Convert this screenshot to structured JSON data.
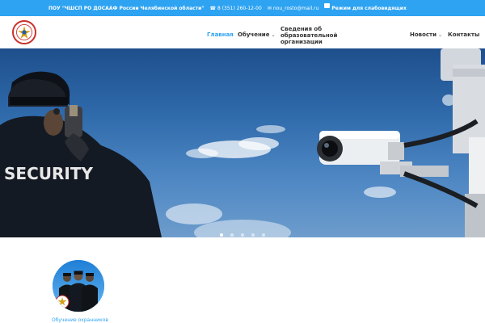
{
  "topbar": {
    "org_name": "ПОУ \"ЧШСП РО ДОСААФ России Челябинской области\"",
    "phone": "8 (351) 260-12-00",
    "email": "nou_rosto@mail.ru",
    "accessibility": "Режим для слабовидящих",
    "bg_color": "#2ea3f2"
  },
  "header": {
    "logo": "dosaaf-emblem-icon",
    "nav": [
      {
        "label": "Главная",
        "active": true
      },
      {
        "label": "Обучение",
        "has_dropdown": true
      },
      {
        "label": "Сведения об образовательной организации"
      },
      {
        "label": "Новости",
        "has_dropdown": true
      },
      {
        "label": "Контакты"
      }
    ]
  },
  "hero": {
    "badge_text": "SECURITY",
    "slides_total": 5,
    "active_slide": 1
  },
  "content": {
    "card_label": "Обучение охранников"
  },
  "colors": {
    "accent": "#2ea3f2",
    "text": "#333333"
  }
}
